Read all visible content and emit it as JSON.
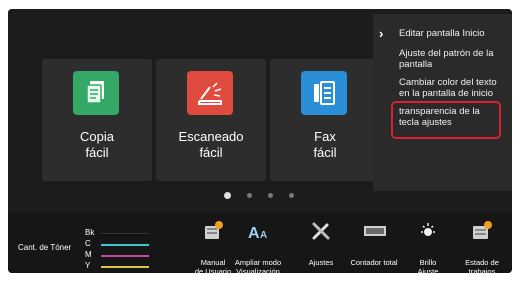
{
  "tiles": [
    {
      "label_line1": "Copia",
      "label_line2": "fácil",
      "icon": "copy-icon",
      "color": "#33a867"
    },
    {
      "label_line1": "Escaneado",
      "label_line2": "fácil",
      "icon": "scan-icon",
      "color": "#e04a3f"
    },
    {
      "label_line1": "Fax",
      "label_line2": "fácil",
      "icon": "fax-icon",
      "color": "#2b8fd8"
    }
  ],
  "page_dots": {
    "count": 4,
    "active_index": 0
  },
  "menu": {
    "items": [
      {
        "label": "Editar pantalla Inicio"
      },
      {
        "label": "Ajuste del patrón de la pantalla"
      },
      {
        "label": "Cambiar color del texto en la pantalla de inicio"
      },
      {
        "label": "transparencia de la tecla ajustes"
      }
    ],
    "selected_index": 3,
    "highlight_color": "#d8202f"
  },
  "toner": {
    "label": "Cant. de Tóner",
    "channels": [
      {
        "name": "Bk",
        "color": "#111111"
      },
      {
        "name": "C",
        "color": "#40c8d0"
      },
      {
        "name": "M",
        "color": "#c84a9a"
      },
      {
        "name": "Y",
        "color": "#d8c83a"
      }
    ]
  },
  "bottom_buttons": [
    {
      "label": "Manual\nde Usuario",
      "icon": "user-manual-icon"
    },
    {
      "label": "Ampliar modo\nVisualización",
      "icon": "enlarge-display-icon"
    },
    {
      "label": "Ajustes",
      "icon": "settings-tools-icon"
    },
    {
      "label": "Contador total",
      "icon": "total-counter-icon"
    },
    {
      "label": "Brillo\nAjuste",
      "icon": "brightness-icon"
    },
    {
      "label": "Estado de\ntrabajos",
      "icon": "job-status-icon"
    }
  ]
}
